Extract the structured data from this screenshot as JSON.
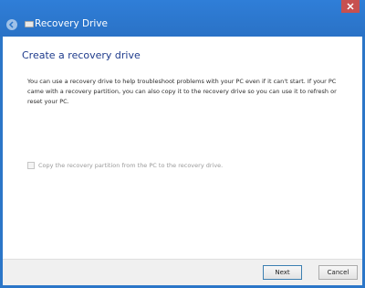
{
  "window": {
    "title": "Recovery Drive",
    "close_glyph": "×"
  },
  "content": {
    "heading": "Create a recovery drive",
    "description": "You can use a recovery drive to help troubleshoot problems with your PC even if it can't start. If your PC came with a recovery partition, you can also copy it to the recovery drive so you can use it to refresh or reset your PC.",
    "copy_partition": {
      "label": "Copy the recovery partition from the PC to the recovery drive.",
      "checked": false,
      "enabled": false
    }
  },
  "footer": {
    "next_label": "Next",
    "cancel_label": "Cancel"
  },
  "icons": {
    "back": "back-arrow-icon",
    "drive": "recovery-drive-icon",
    "close": "close-icon"
  },
  "colors": {
    "titlebar": "#2b76c8",
    "heading": "#1e3b8c",
    "close_button": "#c75050"
  }
}
